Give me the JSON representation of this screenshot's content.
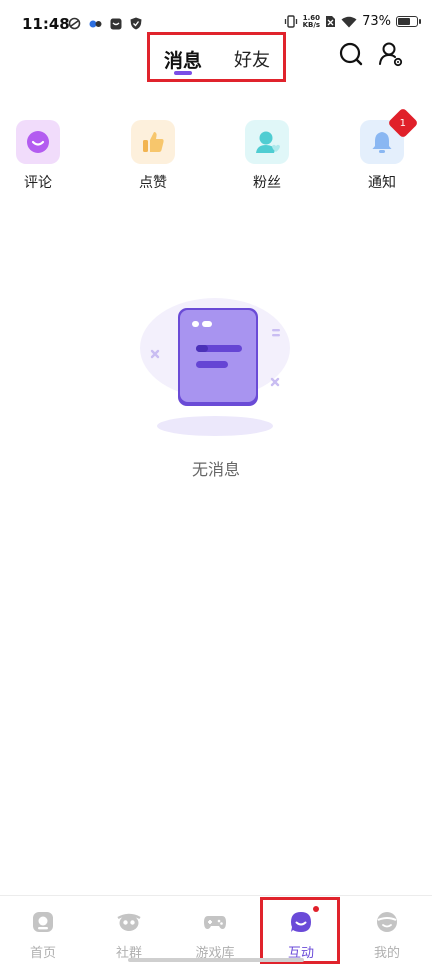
{
  "status_bar": {
    "time": "11:48",
    "net_speed_value": "1.60",
    "net_speed_unit": "KB/s",
    "battery_pct": "73%",
    "battery_level": 0.73,
    "icons": [
      "sync-icon",
      "dual-dot-icon",
      "chat-app-icon",
      "shield-icon",
      "vibrate-icon",
      "no-sim-icon",
      "wifi-icon",
      "battery-icon"
    ]
  },
  "header": {
    "tabs": [
      {
        "label": "消息",
        "active": true
      },
      {
        "label": "好友",
        "active": false
      }
    ],
    "actions": [
      "search-icon",
      "user-settings-icon"
    ]
  },
  "categories": [
    {
      "label": "评论",
      "icon": "comment-icon",
      "color": "#a14be0",
      "bg": "#f1dcfb"
    },
    {
      "label": "点赞",
      "icon": "thumbs-up-icon",
      "color": "#f2b451",
      "bg": "#fdf0dc"
    },
    {
      "label": "粉丝",
      "icon": "fans-icon",
      "color": "#5bcfd3",
      "bg": "#e0f7f8"
    },
    {
      "label": "通知",
      "icon": "bell-icon",
      "color": "#7fb0f0",
      "bg": "#e4effc",
      "badge": "1"
    }
  ],
  "empty_state": {
    "text": "无消息",
    "icon": "empty-message-illustration"
  },
  "bottom_nav": [
    {
      "label": "首页",
      "icon": "home-icon",
      "active": false
    },
    {
      "label": "社群",
      "icon": "community-icon",
      "active": false
    },
    {
      "label": "游戏库",
      "icon": "gamepad-icon",
      "active": false
    },
    {
      "label": "互动",
      "icon": "interact-bubble-icon",
      "active": true,
      "dot": true
    },
    {
      "label": "我的",
      "icon": "profile-icon",
      "active": false
    }
  ],
  "colors": {
    "accent": "#6a4ad8",
    "highlight_box": "#e0232c",
    "badge": "#e0202a"
  }
}
